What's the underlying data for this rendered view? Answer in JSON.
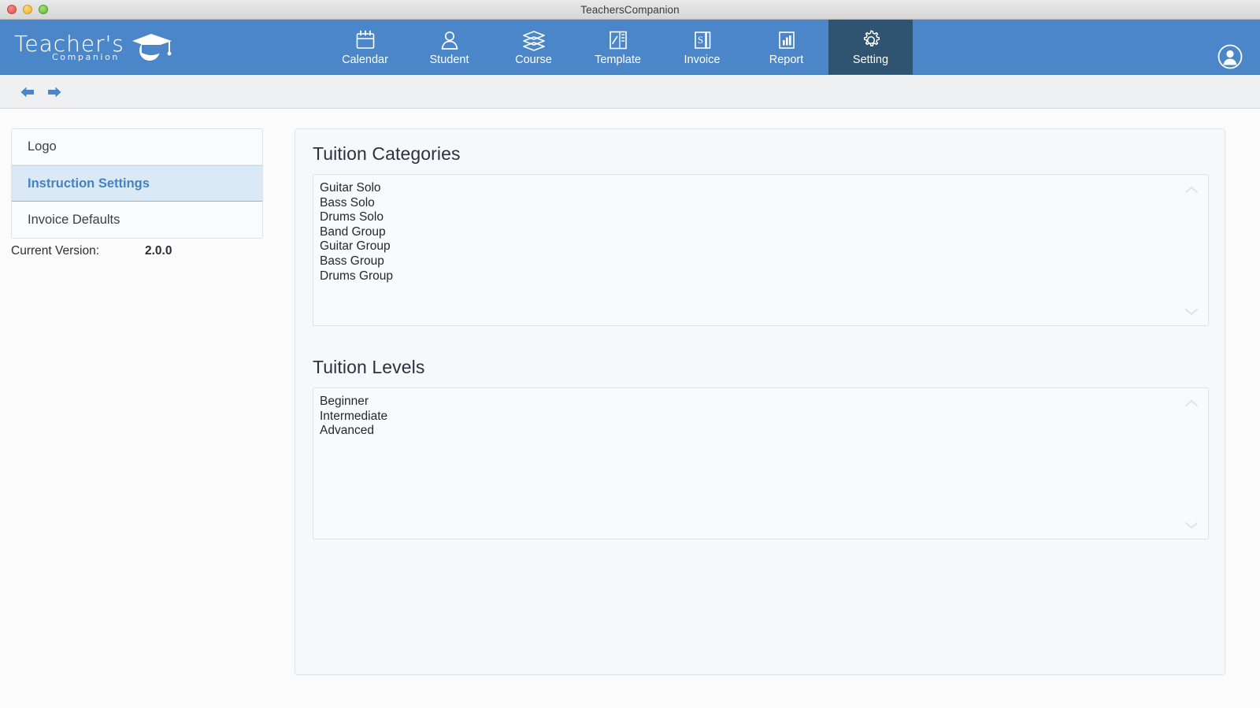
{
  "window": {
    "title": "TeachersCompanion",
    "controls": [
      "close",
      "minimize",
      "maximize"
    ]
  },
  "brand": {
    "name": "Teacher's",
    "tagline": "Companion",
    "cap_icon": "graduation-cap-icon",
    "bar_color": "#4a86c8",
    "active_tab_color": "#2e5472"
  },
  "nav": {
    "items": [
      {
        "label": "Calendar",
        "icon": "calendar-icon",
        "active": false
      },
      {
        "label": "Student",
        "icon": "user-icon",
        "active": false
      },
      {
        "label": "Course",
        "icon": "books-icon",
        "active": false
      },
      {
        "label": "Template",
        "icon": "template-icon",
        "active": false
      },
      {
        "label": "Invoice",
        "icon": "invoice-icon",
        "active": false
      },
      {
        "label": "Report",
        "icon": "chart-bars-icon",
        "active": false
      },
      {
        "label": "Setting",
        "icon": "gear-icon",
        "active": true
      }
    ],
    "account_icon": "user-circle-icon"
  },
  "toolbar": {
    "back_icon": "arrow-left-icon",
    "forward_icon": "arrow-right-icon"
  },
  "sidebar": {
    "items": [
      {
        "label": "Logo",
        "selected": false
      },
      {
        "label": "Instruction Settings",
        "selected": true
      },
      {
        "label": "Invoice Defaults",
        "selected": false
      }
    ],
    "version_label": "Current Version:",
    "version_value": "2.0.0",
    "selected_color": "#4183c4"
  },
  "main": {
    "sections": [
      {
        "title": "Tuition Categories",
        "items": [
          "Guitar Solo",
          "Bass Solo",
          "Drums Solo",
          "Band Group",
          "Guitar Group",
          "Bass Group",
          "Drums Group"
        ],
        "scroll_up_icon": "chevron-up-icon",
        "scroll_down_icon": "chevron-down-icon"
      },
      {
        "title": "Tuition Levels",
        "items": [
          "Beginner",
          "Intermediate",
          "Advanced"
        ],
        "scroll_up_icon": "chevron-up-icon",
        "scroll_down_icon": "chevron-down-icon"
      }
    ]
  }
}
